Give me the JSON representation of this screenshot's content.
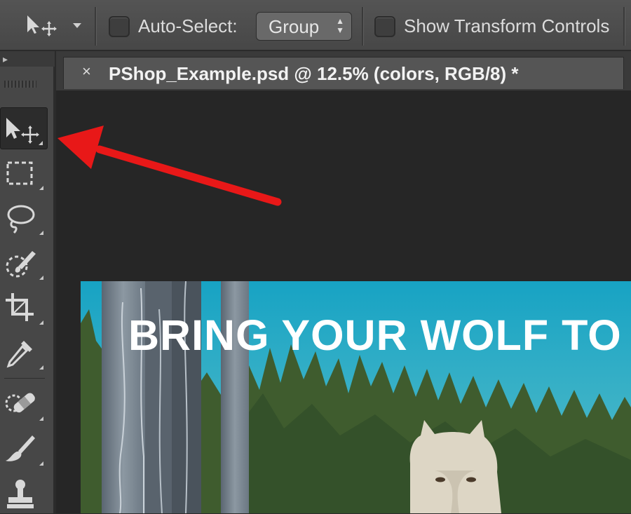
{
  "options_bar": {
    "auto_select_label": "Auto-Select:",
    "auto_select_value": "Group",
    "show_transform_label": "Show Transform Controls"
  },
  "document_tab": {
    "title": "PShop_Example.psd @ 12.5% (colors, RGB/8) *",
    "close_glyph": "×"
  },
  "toolbar": {
    "tools": [
      "move-tool",
      "rectangular-marquee-tool",
      "lasso-tool",
      "quick-selection-tool",
      "crop-tool",
      "eyedropper-tool",
      "spot-healing-brush-tool",
      "brush-tool",
      "clone-stamp-tool"
    ],
    "selected": "move-tool"
  },
  "canvas": {
    "headline": "BRING YOUR WOLF TO"
  },
  "colors": {
    "annotation_arrow": "#e81818",
    "sky": "#1fa5c0",
    "forest": "#3d5a2c"
  }
}
